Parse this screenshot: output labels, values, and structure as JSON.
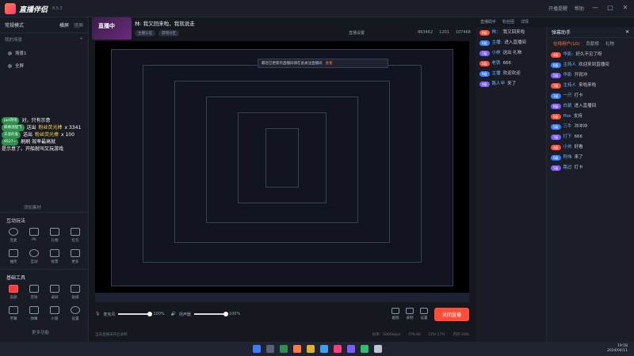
{
  "app": {
    "name": "直播伴侣",
    "version": "8.5.3",
    "top_links": [
      "开播提醒",
      "帮助"
    ],
    "window_controls": [
      "—",
      "□",
      "✕"
    ]
  },
  "left": {
    "scene_title": "常规模式",
    "scene_tabs": [
      "横屏",
      "竖屏"
    ],
    "scene_list_label": "我的场景",
    "scene_items": [
      "场景1",
      "全屏"
    ],
    "add_source": "添加素材",
    "interact_title": "互动玩法",
    "interact_tools": [
      "连麦",
      "PK",
      "礼物",
      "红包",
      "抽奖",
      "互动",
      "投票",
      "更多"
    ],
    "basic_title": "基础工具",
    "basic_tools": [
      "美颜",
      "音效",
      "录屏",
      "贴纸",
      "字幕",
      "弹幕",
      "小窗",
      "设置"
    ],
    "more_label": "更多功能"
  },
  "room": {
    "thumb_text": "直播中",
    "title": "林: 我又回来啦，我就说走",
    "tags": [
      "主播认证",
      "游戏分区"
    ],
    "actions": "直播设置",
    "stats": [
      "863462",
      "1201",
      "107468"
    ]
  },
  "preview": {
    "popup_text": "最近已更新的直播间请在此关注直播间",
    "popup_link": "查看"
  },
  "controls": {
    "mic_label": "麦克风",
    "mic_value": "100%",
    "mic_level": 1.0,
    "speaker_label": "扬声器",
    "speaker_value": "100%",
    "speaker_level": 1.0,
    "buttons": [
      "截图",
      "录制",
      "设置"
    ],
    "live_button": "关闭直播"
  },
  "status": {
    "hint": "当前直播未开启录制",
    "items": [
      "码率：5000kbps",
      "FPS:60",
      "CPU:17%",
      "内存:20%"
    ]
  },
  "right": {
    "top_tabs": [
      "直播助手",
      "粉丝团",
      "详情"
    ],
    "chat_a_title": "弹幕助手",
    "chat_b_tabs": [
      "在线用户(10)",
      "贡献榜",
      "礼物"
    ],
    "messages_a": [
      {
        "badge": "8级",
        "name": "林：",
        "text": "我又回来啦"
      },
      {
        "badge": "6级",
        "name": "主播:",
        "text": "进入直播间"
      },
      {
        "badge": "7级",
        "name": "小林",
        "text": "送出 礼物"
      },
      {
        "badge": "5级",
        "name": "老铁",
        "text": "666"
      },
      {
        "badge": "9级",
        "name": "主播",
        "text": "欢迎欢迎"
      },
      {
        "badge": "4级",
        "name": "路人甲",
        "text": "来了"
      }
    ],
    "messages_b": [
      {
        "badge": "4级",
        "name": "华影:",
        "text": "好久不见了呀"
      },
      {
        "badge": "6级",
        "name": "主持人",
        "text": "欢迎来到直播间"
      },
      {
        "badge": "5级",
        "name": "华影",
        "text": "开就冲"
      },
      {
        "badge": "7级",
        "name": "主持人",
        "text": "来啦来啦"
      },
      {
        "badge": "3级",
        "name": "一只",
        "text": "打卡"
      },
      {
        "badge": "8级",
        "name": "白鼠",
        "text": "进入直播间"
      },
      {
        "badge": "6级",
        "name": "ffox",
        "text": "支持"
      },
      {
        "badge": "5级",
        "name": "三牛",
        "text": "冲冲冲"
      },
      {
        "badge": "7级",
        "name": "打下",
        "text": "666"
      },
      {
        "badge": "4级",
        "name": "小刘",
        "text": "好看"
      },
      {
        "badge": "6级",
        "name": "阿伟",
        "text": "来了"
      },
      {
        "badge": "5级",
        "name": "路过",
        "text": "打卡"
      }
    ]
  },
  "overlay": {
    "lines": [
      {
        "name": "ppt改场",
        "text": "对，只有示意",
        "gift": ""
      },
      {
        "name": "麻辣烫配飞",
        "text": "送出",
        "gift": "粉丝荧光棒",
        "count": "x 3341"
      },
      {
        "name": "天涯的鬼",
        "text": "送出",
        "gift": "粉丝荧光棒",
        "count": "x 100"
      },
      {
        "name": "9527~",
        "text": "刷刷 效率最高就",
        "gift": ""
      },
      {
        "name": "",
        "text": "是示意了。开船就叫又玩游戏",
        "gift": ""
      }
    ]
  },
  "tray": {
    "time": "19:58",
    "date": "2024/04/11"
  }
}
